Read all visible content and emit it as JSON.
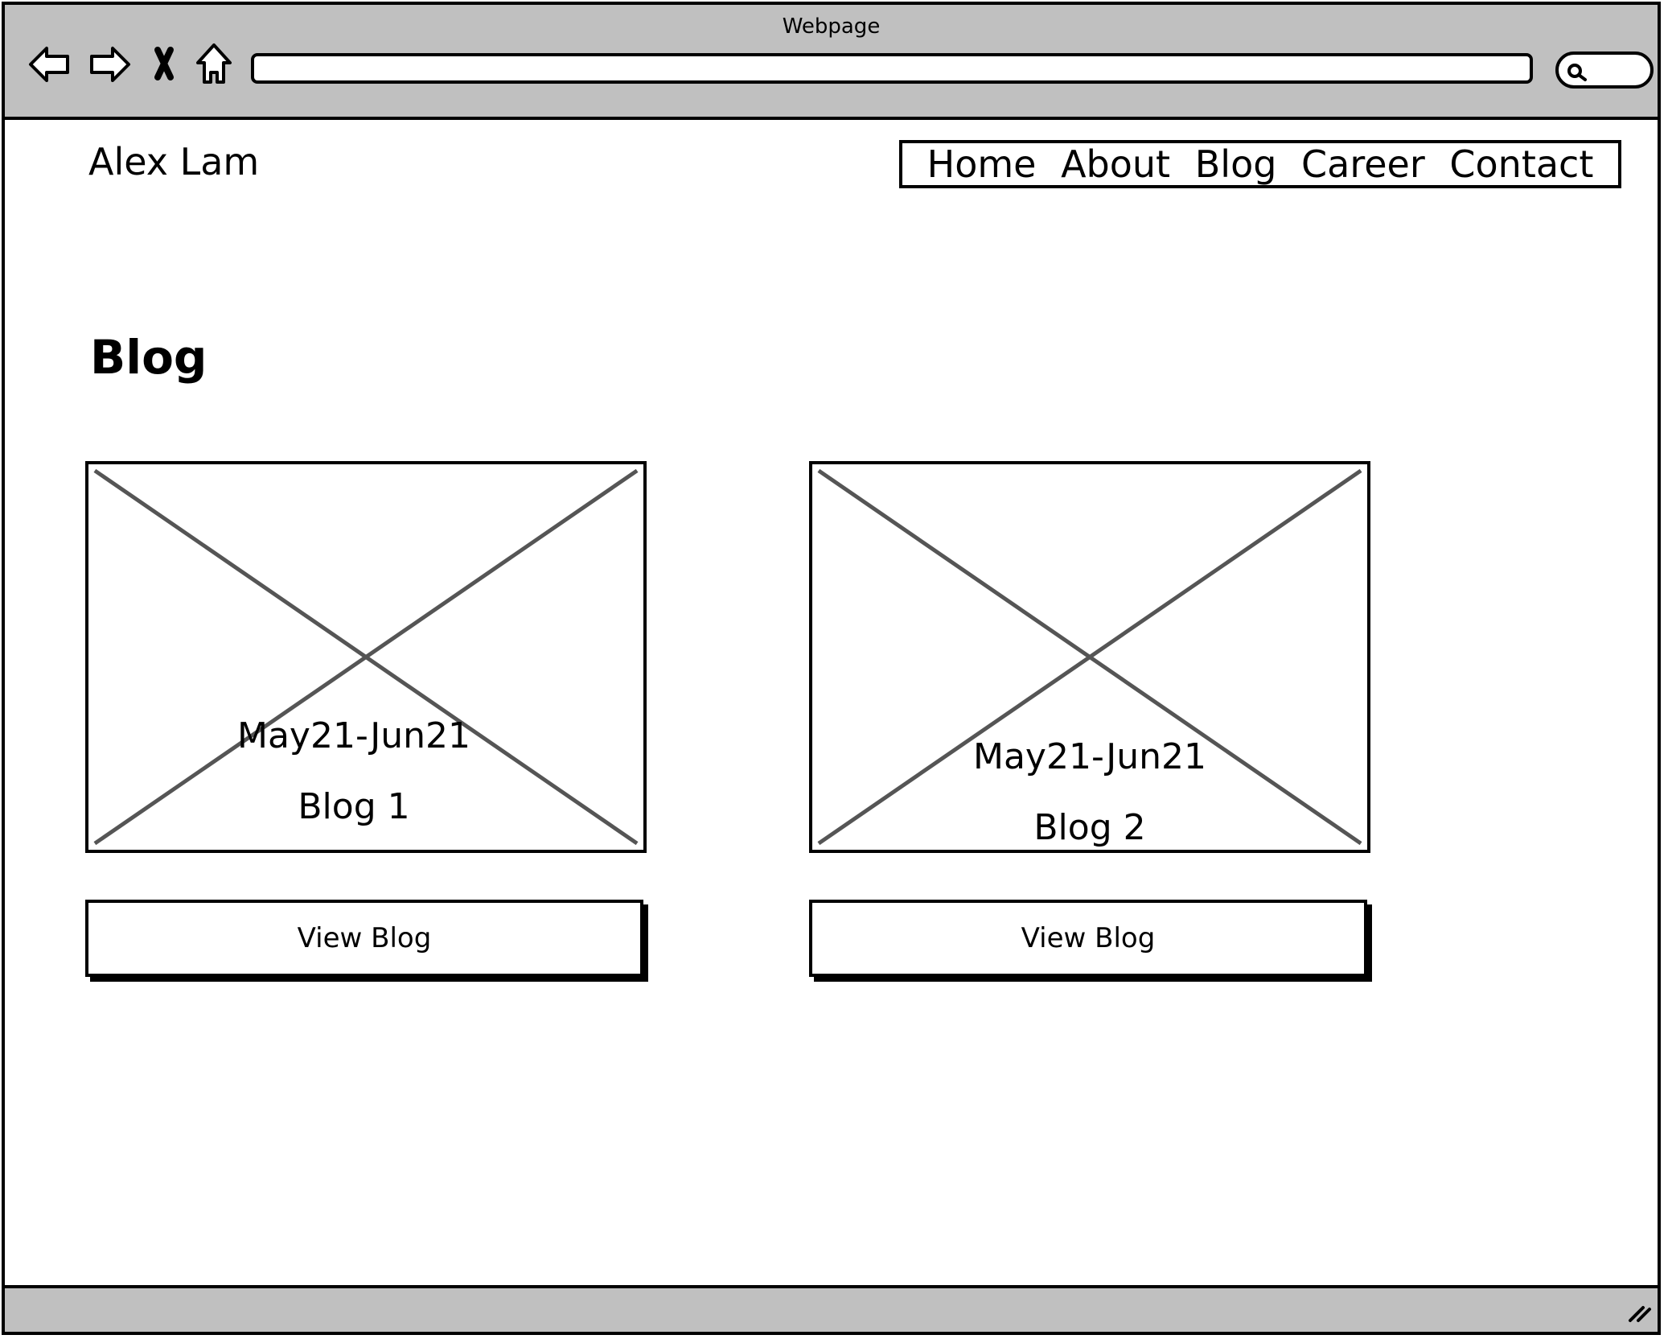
{
  "browser": {
    "window_title": "Webpage",
    "address_value": "",
    "nav_icons": [
      "back-arrow-icon",
      "forward-arrow-icon",
      "stop-icon",
      "home-icon"
    ],
    "search_icon": "search-icon",
    "resize_icon": "resize-grip-icon"
  },
  "site": {
    "name": "Alex Lam",
    "nav": [
      {
        "label": "Home"
      },
      {
        "label": "About"
      },
      {
        "label": "Blog"
      },
      {
        "label": "Career"
      },
      {
        "label": "Contact"
      }
    ]
  },
  "main": {
    "heading": "Blog",
    "cards": [
      {
        "date": "May21-Jun21",
        "title": "Blog 1",
        "button_label": "View Blog",
        "image_icon": "image-placeholder-icon"
      },
      {
        "date": "May21-Jun21",
        "title": "Blog 2",
        "button_label": "View Blog",
        "image_icon": "image-placeholder-icon"
      }
    ]
  },
  "colors": {
    "chrome": "#c0c0c0",
    "ink": "#000000",
    "placeholder_lines": "#555555",
    "background": "#ffffff"
  }
}
